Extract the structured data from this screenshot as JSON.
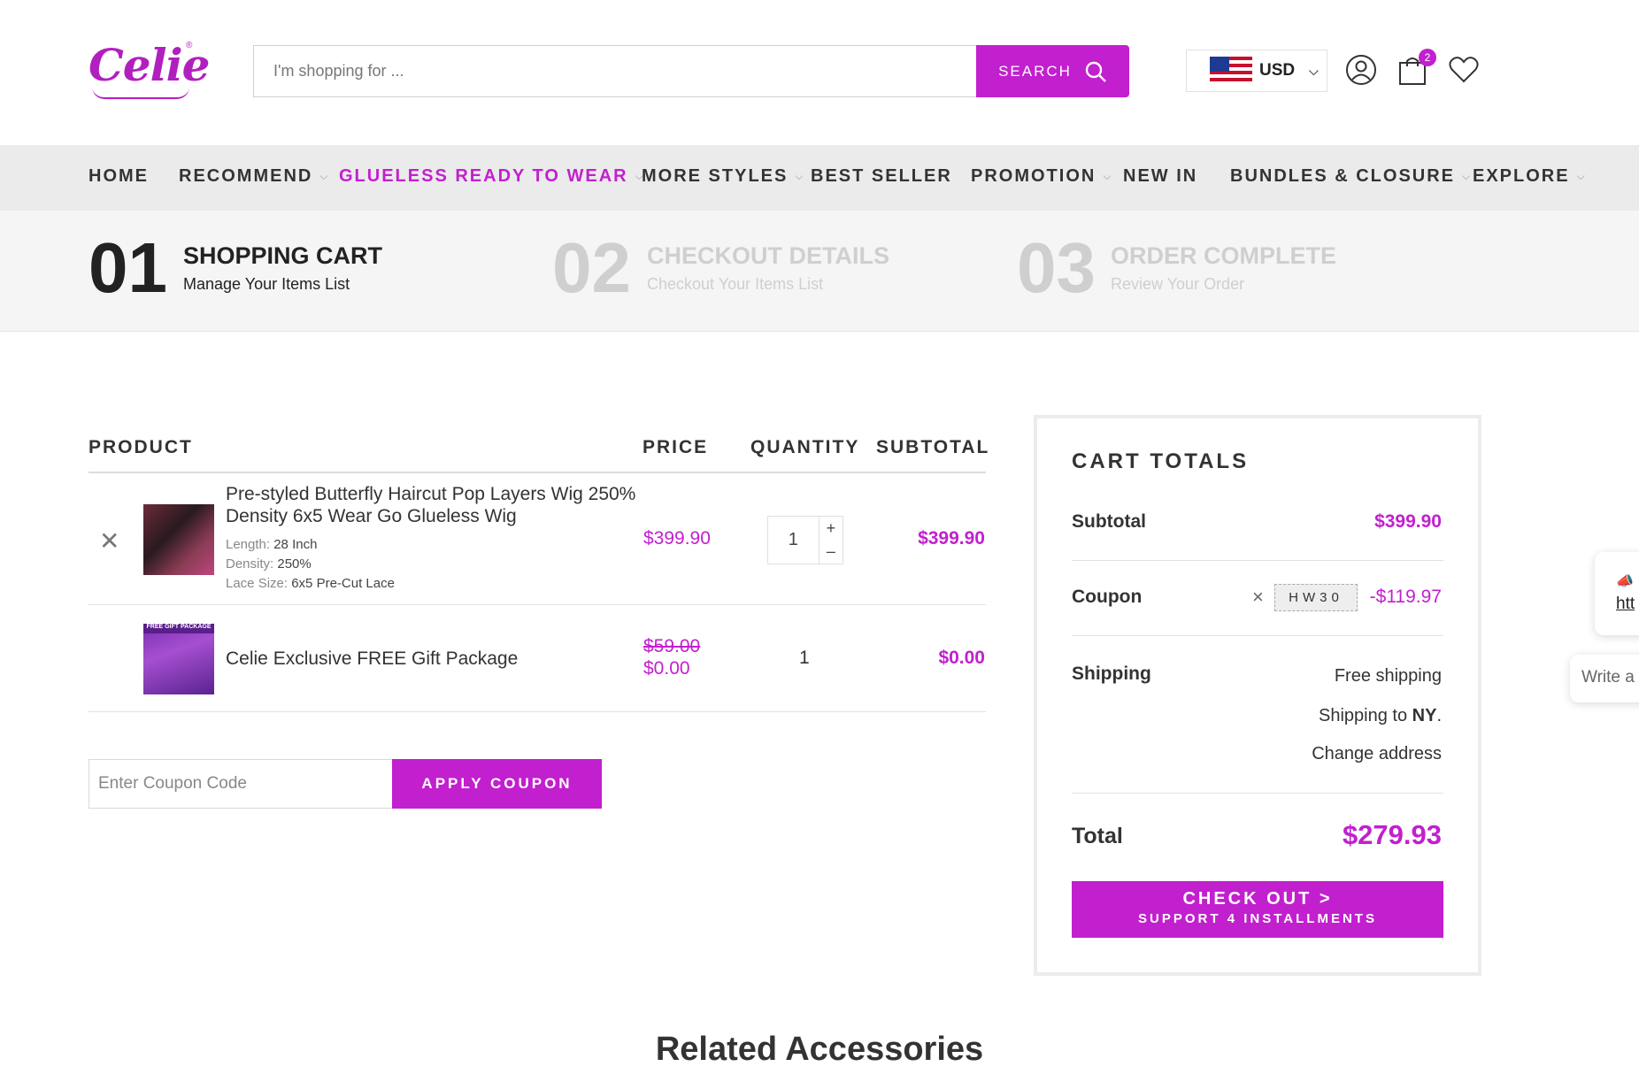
{
  "header": {
    "logo_text": "Celie",
    "search_placeholder": "I'm shopping for ...",
    "search_button": "SEARCH",
    "currency": "USD",
    "cart_count": "2"
  },
  "nav": {
    "items": [
      {
        "label": "HOME"
      },
      {
        "label": "RECOMMEND"
      },
      {
        "label": "GLUELESS READY TO WEAR"
      },
      {
        "label": "MORE STYLES"
      },
      {
        "label": "BEST SELLER"
      },
      {
        "label": "PROMOTION"
      },
      {
        "label": "NEW IN"
      },
      {
        "label": "BUNDLES & CLOSURE"
      },
      {
        "label": "EXPLORE"
      }
    ]
  },
  "steps": [
    {
      "num": "01",
      "title": "SHOPPING CART",
      "sub": "Manage Your Items List"
    },
    {
      "num": "02",
      "title": "CHECKOUT DETAILS",
      "sub": "Checkout Your Items List"
    },
    {
      "num": "03",
      "title": "ORDER COMPLETE",
      "sub": "Review Your Order"
    }
  ],
  "table": {
    "headers": {
      "product": "PRODUCT",
      "price": "PRICE",
      "quantity": "QUANTITY",
      "subtotal": "SUBTOTAL"
    },
    "rows": [
      {
        "name_line1": "Pre-styled Butterfly Haircut Pop Layers Wig 250%",
        "name_line2": "Density 6x5 Wear Go Glueless Wig",
        "attrs": [
          {
            "label": "Length:",
            "value": "28 Inch"
          },
          {
            "label": "Density:",
            "value": "250%"
          },
          {
            "label": "Lace Size:",
            "value": "6x5 Pre-Cut Lace"
          }
        ],
        "price": "$399.90",
        "quantity": "1",
        "subtotal": "$399.90"
      },
      {
        "name": "Celie Exclusive FREE Gift Package",
        "thumb_label": "FREE GIFT PACKAGE",
        "old_price": "$59.00",
        "price": "$0.00",
        "quantity": "1",
        "subtotal": "$0.00"
      }
    ]
  },
  "coupon": {
    "placeholder": "Enter Coupon Code",
    "button": "APPLY COUPON"
  },
  "totals": {
    "title": "CART TOTALS",
    "subtotal_label": "Subtotal",
    "subtotal": "$399.90",
    "coupon_label": "Coupon",
    "coupon_code": "HW30",
    "coupon_discount": "-$119.97",
    "shipping_label": "Shipping",
    "shipping_method": "Free shipping",
    "shipping_to_prefix": "Shipping to ",
    "shipping_state": "NY",
    "shipping_to_suffix": ".",
    "change_address": "Change address",
    "total_label": "Total",
    "total": "$279.93",
    "checkout_main": "CHECK OUT >",
    "checkout_sub": "SUPPORT 4 INSTALLMENTS"
  },
  "related_title": "Related Accessories",
  "floating": {
    "popup_text": "htt",
    "chat_placeholder": "Write a"
  },
  "colors": {
    "accent": "#c21fcf"
  }
}
